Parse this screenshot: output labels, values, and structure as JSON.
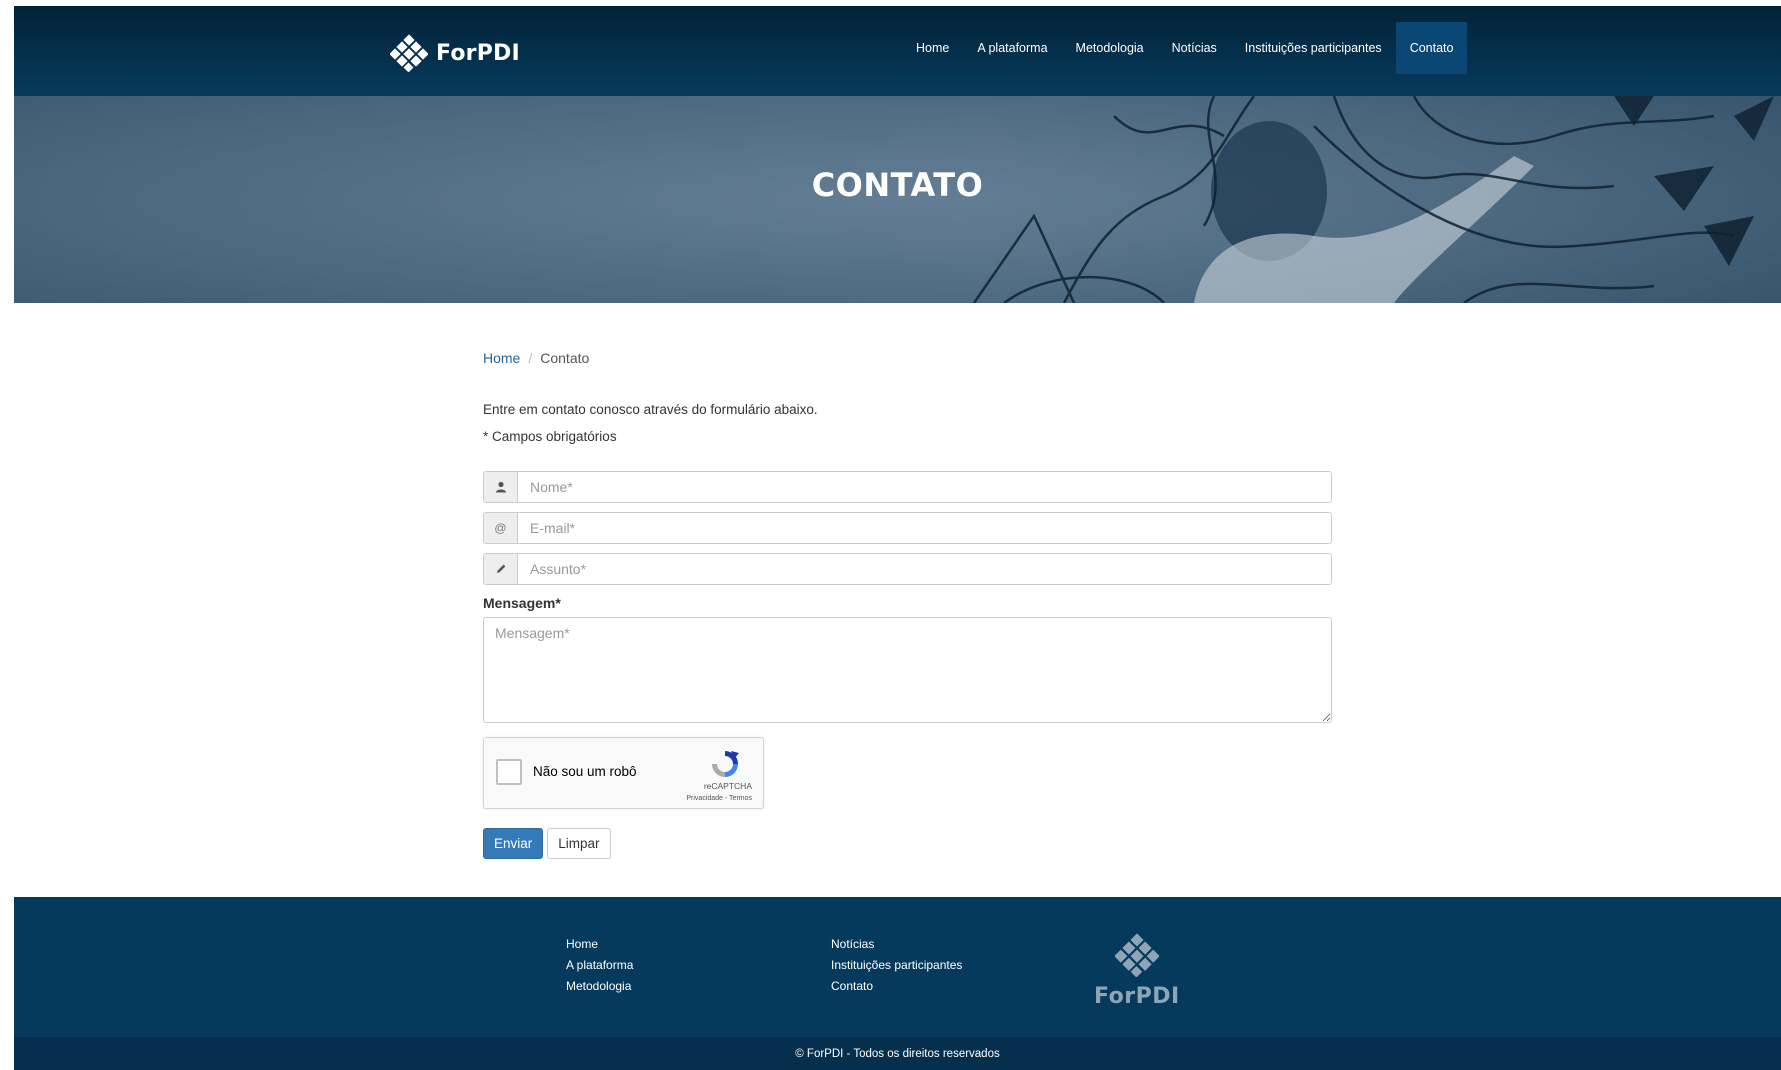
{
  "header": {
    "brand": "ForPDI",
    "nav": [
      {
        "label": "Home"
      },
      {
        "label": "A plataforma"
      },
      {
        "label": "Metodologia"
      },
      {
        "label": "Notícias"
      },
      {
        "label": "Instituições participantes"
      },
      {
        "label": "Contato"
      }
    ],
    "active_item": "Contato"
  },
  "hero": {
    "title": "CONTATO"
  },
  "breadcrumb": {
    "home": "Home",
    "separator": "/",
    "current": "Contato"
  },
  "form": {
    "intro": "Entre em contato conosco através do formulário abaixo.",
    "required_note": "* Campos obrigatórios",
    "name_placeholder": "Nome*",
    "email_placeholder": "E-mail*",
    "subject_placeholder": "Assunto*",
    "message_label": "Mensagem*",
    "message_placeholder": "Mensagem*",
    "icons": {
      "name": "user-icon",
      "email": "at-icon",
      "subject": "pencil-icon"
    }
  },
  "captcha": {
    "label": "Não sou um robô",
    "brand": "reCAPTCHA",
    "links": "Privacidade - Termos"
  },
  "buttons": {
    "submit": "Enviar",
    "clear": "Limpar"
  },
  "footer": {
    "col1": [
      "Home",
      "A plataforma",
      "Metodologia"
    ],
    "col2": [
      "Notícias",
      "Instituições participantes",
      "Contato"
    ],
    "logo_text": "ForPDI",
    "copyright": "© ForPDI - Todos os direitos reservados"
  },
  "colors": {
    "header_bg": "#063a5c",
    "primary_button": "#337ab7",
    "link": "#2a6496",
    "footer_bg": "#063a5c",
    "copyright_bg": "#052f4c"
  }
}
